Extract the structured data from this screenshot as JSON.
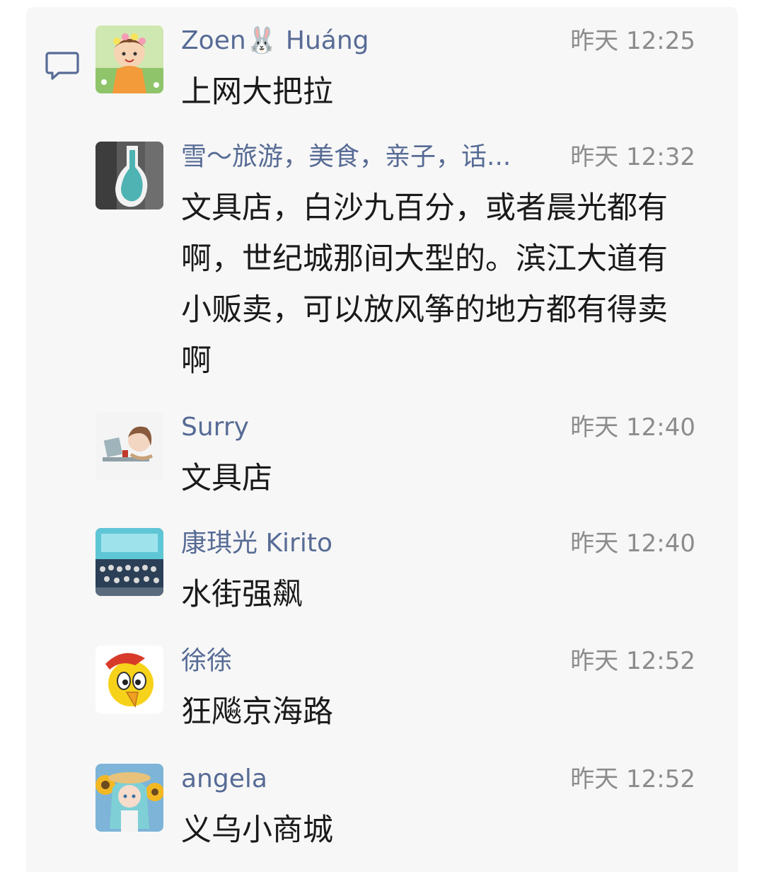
{
  "comments": [
    {
      "name": "Zoen🐰 Huáng",
      "time": "昨天 12:25",
      "text": "上网大把拉",
      "avatar": "girl-flower-crown-avatar"
    },
    {
      "name": "雪～旅游，美食，亲子，话...",
      "time": "昨天 12:32",
      "text": "文具店，白沙九百分，或者晨光都有啊，世纪城那间大型的。滨江大道有小贩卖，可以放风筝的地方都有得卖啊",
      "avatar": "teal-vase-avatar"
    },
    {
      "name": "Surry",
      "time": "昨天 12:40",
      "text": "文具店",
      "avatar": "girl-at-desk-avatar"
    },
    {
      "name": "康琪光 Kirito",
      "time": "昨天 12:40",
      "text": "水街强飙",
      "avatar": "group-photo-avatar"
    },
    {
      "name": "徐徐",
      "time": "昨天 12:52",
      "text": "狂飚京海路",
      "avatar": "yellow-bird-avatar"
    },
    {
      "name": "angela",
      "time": "昨天 12:52",
      "text": "义乌小商城",
      "avatar": "girl-sunflower-avatar"
    }
  ],
  "colors": {
    "name": "#576b95",
    "time": "#8c8c8c",
    "text": "#1a1a1a",
    "panel": "#f7f7f7"
  },
  "icons": {
    "comment": "comment-icon"
  }
}
